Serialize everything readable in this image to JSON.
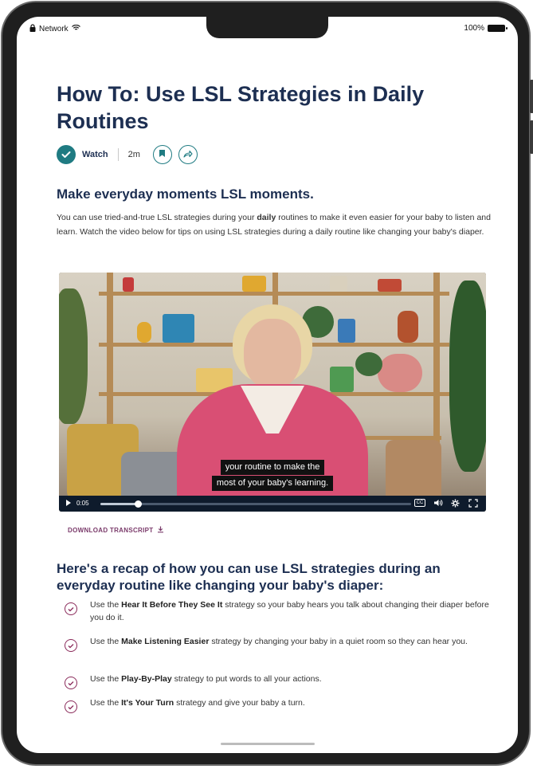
{
  "status_bar": {
    "network": "Network",
    "battery": "100%"
  },
  "article": {
    "title": "How To: Use LSL Strategies in Daily Routines",
    "watch_label": "Watch",
    "duration": "2m",
    "section_heading": "Make everyday moments LSL moments.",
    "intro_before_bold": "You can use tried-and-true LSL strategies during your ",
    "intro_bold": "daily",
    "intro_after_bold": " routines to make it even easier for your baby to listen and learn. Watch the video below for tips on using LSL strategies during a daily routine like changing your baby's diaper."
  },
  "video": {
    "caption_line1": "your routine to make the",
    "caption_line2": "most of your baby's learning.",
    "time": "0:05",
    "progress": 0.12
  },
  "download_label": "DOWNLOAD TRANSCRIPT",
  "recap": {
    "heading": "Here's a recap of how you can use LSL strategies during an everyday routine like changing your baby's diaper:",
    "items": [
      {
        "before": "Use the ",
        "bold": "Hear It Before They See It",
        "after": " strategy so your baby hears you talk about changing their diaper before you do it."
      },
      {
        "before": "Use the ",
        "bold": "Make Listening Easier",
        "after": " strategy by changing your baby in a quiet room so they can hear you."
      },
      {
        "before": "Use the ",
        "bold": "Play-By-Play",
        "after": " strategy to put words to all your actions."
      },
      {
        "before": "Use the ",
        "bold": "It's Your Turn",
        "after": " strategy and give your baby a turn."
      }
    ]
  }
}
